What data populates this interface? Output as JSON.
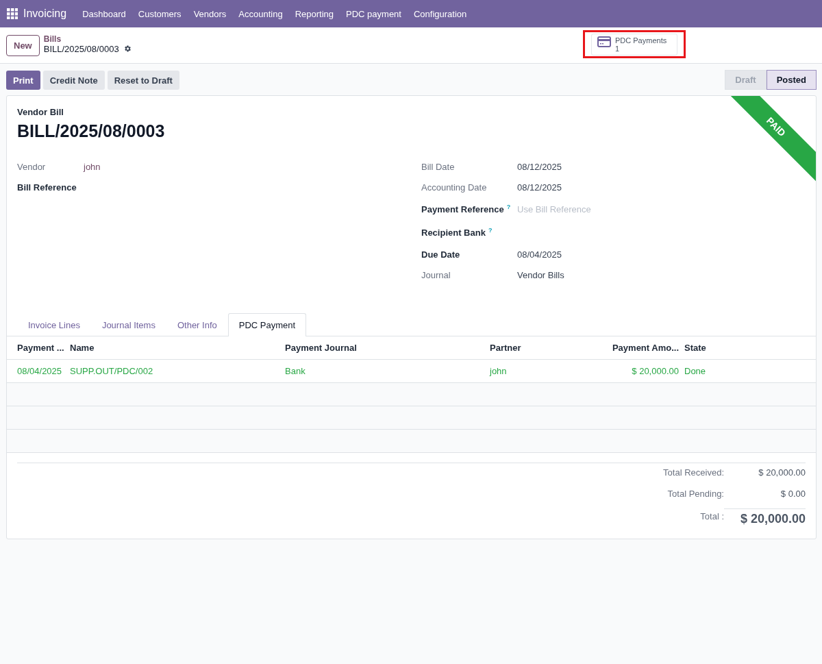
{
  "navbar": {
    "app": "Invoicing",
    "menu": [
      "Dashboard",
      "Customers",
      "Vendors",
      "Accounting",
      "Reporting",
      "PDC payment",
      "Configuration"
    ]
  },
  "control_panel": {
    "new_button": "New",
    "breadcrumb": "Bills",
    "record": "BILL/2025/08/0003",
    "smart_button": {
      "label": "PDC Payments",
      "count": "1",
      "highlighted": true
    }
  },
  "actions": [
    {
      "label": "Print",
      "primary": true
    },
    {
      "label": "Credit Note",
      "primary": false
    },
    {
      "label": "Reset to Draft",
      "primary": false
    }
  ],
  "statusbar": [
    {
      "label": "Draft",
      "selected": false
    },
    {
      "label": "Posted",
      "selected": true
    }
  ],
  "form": {
    "subtitle": "Vendor Bill",
    "title": "BILL/2025/08/0003",
    "ribbon": "PAID",
    "left_fields": [
      {
        "label": "Vendor",
        "value": "john",
        "bold": false,
        "link": true
      },
      {
        "label": "Bill Reference",
        "bold": true
      }
    ],
    "right_fields": [
      {
        "label": "Bill Date",
        "value": "08/12/2025",
        "bold": false
      },
      {
        "label": "Accounting Date",
        "value": "08/12/2025",
        "bold": false
      },
      {
        "label": "Payment Reference",
        "help": "?",
        "placeholder": "Use Bill Reference",
        "bold": true
      },
      {
        "label": "Recipient Bank",
        "help": "?",
        "bold": true
      },
      {
        "label": "Due Date",
        "value": "08/04/2025",
        "bold": true
      },
      {
        "label": "Journal",
        "value": "Vendor Bills",
        "bold": false
      }
    ]
  },
  "tabs": [
    {
      "label": "Invoice Lines",
      "selected": false
    },
    {
      "label": "Journal Items",
      "selected": false
    },
    {
      "label": "Other Info",
      "selected": false
    },
    {
      "label": "PDC Payment",
      "selected": true
    }
  ],
  "table": {
    "columns": [
      "Payment ...",
      "Name",
      "Payment Journal",
      "Partner",
      "Payment Amo...",
      "State"
    ],
    "rows": [
      [
        "08/04/2025",
        "SUPP.OUT/PDC/002",
        "Bank",
        "john",
        "$ 20,000.00",
        "Done"
      ]
    ]
  },
  "totals": [
    {
      "label": "Total Received:",
      "value": "$ 20,000.00",
      "grand": false
    },
    {
      "label": "Total Pending:",
      "value": "$ 0.00",
      "grand": false
    },
    {
      "label": "Total :",
      "value": "$ 20,000.00",
      "grand": true
    }
  ]
}
